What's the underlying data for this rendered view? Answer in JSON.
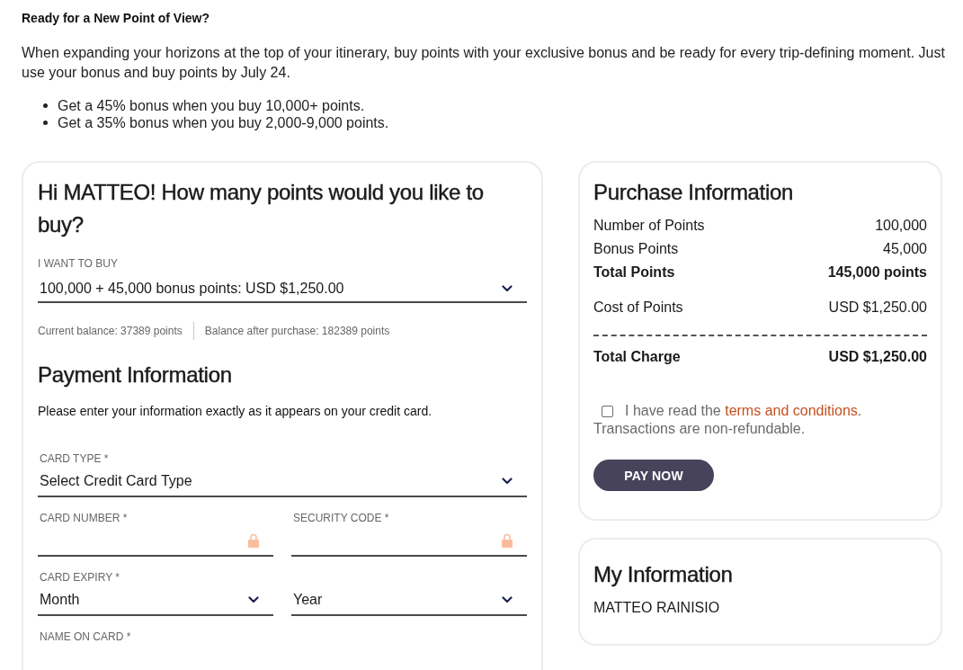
{
  "intro": {
    "heading": "Ready for a New Point of View?",
    "paragraph": "When expanding your horizons at the top of your itinerary, buy points with your exclusive bonus and be ready for every trip-defining moment. Just use your bonus and buy points by July 24.",
    "bullets": [
      "Get a 45% bonus when you buy 10,000+ points.",
      "Get a 35% bonus when you buy 2,000-9,000 points."
    ]
  },
  "points_form": {
    "title": "Hi MATTEO! How many points would you like to buy?",
    "quantity": {
      "label": "I WANT TO BUY",
      "value": "100,000 + 45,000 bonus points: USD $1,250.00"
    },
    "balances": [
      "Current balance: 37389 points",
      "Balance after purchase: 182389 points"
    ]
  },
  "payment": {
    "title": "Payment Information",
    "instructions": "Please enter your information exactly as it appears on your credit card.",
    "field_rows": [
      [
        {
          "kind": "select",
          "label": "CARD TYPE *",
          "value": "Select Credit Card Type"
        }
      ],
      [
        {
          "kind": "secure",
          "label": "CARD NUMBER *"
        },
        {
          "kind": "secure",
          "label": "SECURITY CODE *"
        }
      ],
      [
        {
          "kind": "select",
          "label": "CARD EXPIRY *",
          "value": "Month"
        },
        {
          "kind": "select",
          "value": "Year"
        }
      ],
      [
        {
          "kind": "label_only",
          "label": "NAME ON CARD *"
        }
      ]
    ]
  },
  "purchase": {
    "title": "Purchase Information",
    "lines": [
      {
        "label": "Number of Points",
        "value": "100,000",
        "bold": false
      },
      {
        "label": "Bonus Points",
        "value": "45,000",
        "bold": false
      },
      {
        "label": "Total Points",
        "value": "145,000 points",
        "bold": true
      },
      {
        "label": "Cost of Points",
        "value": "USD $1,250.00",
        "bold": false
      }
    ],
    "total": {
      "label": "Total Charge",
      "value": "USD $1,250.00"
    },
    "terms": {
      "checked": false,
      "before": "I have read the ",
      "link": "terms and conditions",
      "after": ".",
      "note": "Transactions are non-refundable."
    },
    "button": "PAY NOW"
  },
  "my_information": {
    "title": "My Information",
    "name": "MATTEO RAINISIO"
  }
}
